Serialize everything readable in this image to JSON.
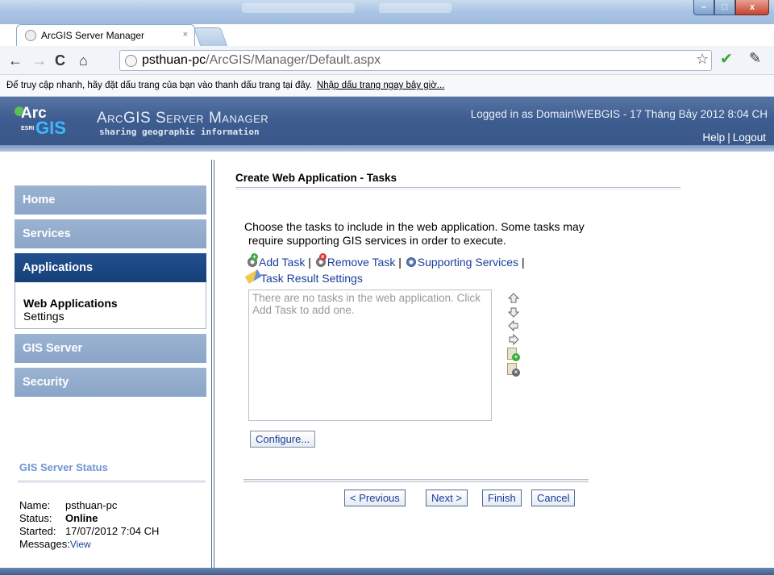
{
  "browser": {
    "tab_title": "ArcGIS Server Manager",
    "tab_close": "×",
    "url_host": "psthuan-pc",
    "url_path": "/ArcGIS/Manager/Default.aspx",
    "bookmark_hint": "Để truy cập nhanh, hãy đặt dấu trang của bạn vào thanh dấu trang tại đây.",
    "bookmark_link": "Nhập dấu trang ngay bây giờ...",
    "window_buttons": [
      "–",
      "□",
      "x"
    ]
  },
  "header": {
    "logo_arc": "Arc",
    "logo_gis": "GIS",
    "logo_esri": "ESRI",
    "app_name": "ArcGIS Server Manager",
    "tagline": "sharing geographic information",
    "logged_in": "Logged in as Domain\\WEBGIS - 17 Tháng Bảy 2012 8:04 CH",
    "help": "Help",
    "separator": "|",
    "logout": "Logout"
  },
  "sidebar": {
    "home": "Home",
    "services": "Services",
    "applications": "Applications",
    "sub_items": [
      "Web Applications",
      "Settings"
    ],
    "gis_server": "GIS Server",
    "security": "Security"
  },
  "status": {
    "heading": "GIS Server Status",
    "name_label": "Name:",
    "name_value": "psthuan-pc",
    "status_label": "Status:",
    "status_value": "Online",
    "started_label": "Started:",
    "started_value": "17/07/2012 7:04 CH",
    "messages_label": "Messages:",
    "messages_link": "View"
  },
  "content": {
    "title": "Create Web Application - Tasks",
    "intro_line1": "Choose the tasks to include in the web application. Some tasks may",
    "intro_line2": "require supporting GIS services in order to execute.",
    "add_task": "Add Task",
    "remove_task": "Remove Task",
    "supporting_services": "Supporting Services",
    "task_result_settings": "Task Result Settings",
    "sep": "|",
    "empty_list_text": "There are no tasks in the web application. Click Add Task to add one.",
    "configure": "Configure..."
  },
  "wizard": {
    "previous": "< Previous",
    "next": "Next >",
    "finish": "Finish",
    "cancel": "Cancel"
  },
  "colors": {
    "header_blue": "#3e5d90",
    "nav_inactive": "#8aa5c8",
    "nav_active": "#163f78",
    "link": "#1a3e9a",
    "status_heading": "#6e95d0"
  }
}
